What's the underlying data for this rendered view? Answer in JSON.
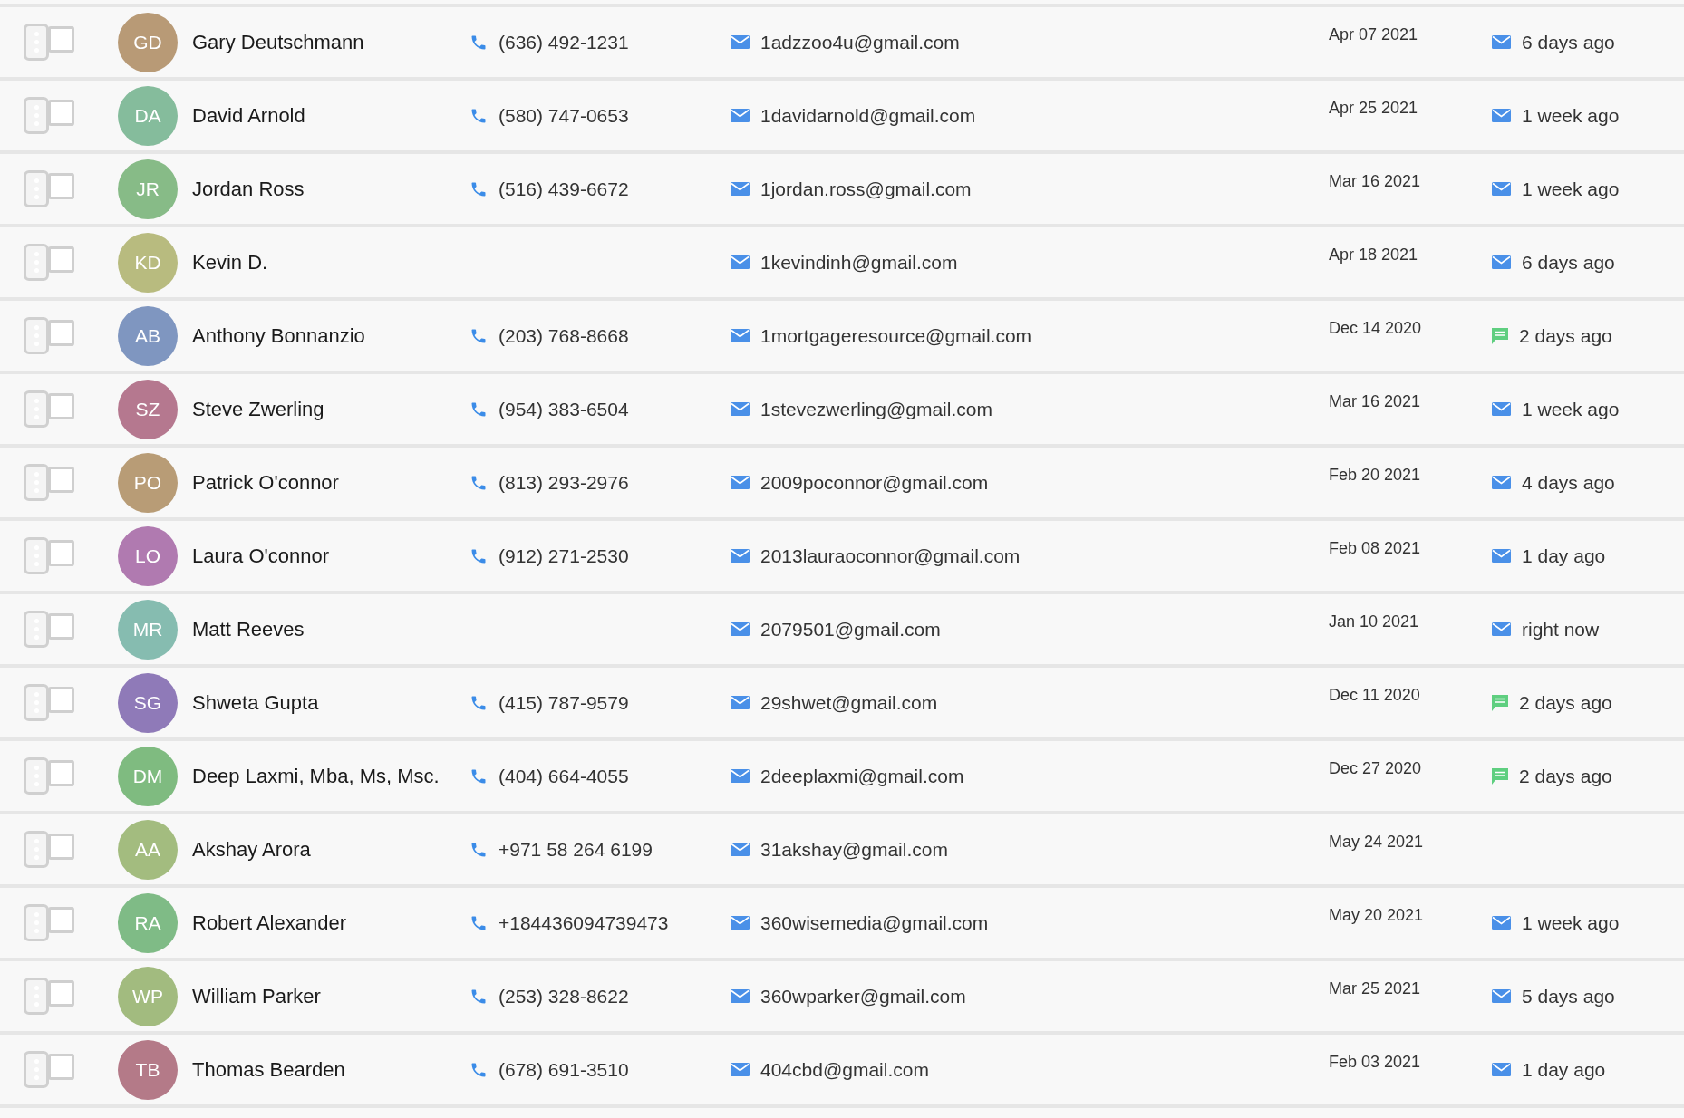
{
  "contacts": [
    {
      "initials": "GD",
      "color": "#b89a76",
      "name": "Gary Deutschmann",
      "checked": false,
      "phone": "(636) 492-1231",
      "email": "1adzzoo4u@gmail.com",
      "date": "Apr 07 2021",
      "last_contact": {
        "kind": "email",
        "text": "6 days ago"
      }
    },
    {
      "initials": "DA",
      "color": "#85bc9c",
      "name": "David Arnold",
      "checked": false,
      "phone": "(580) 747-0653",
      "email": "1davidarnold@gmail.com",
      "date": "Apr 25 2021",
      "last_contact": {
        "kind": "email",
        "text": "1 week ago"
      }
    },
    {
      "initials": "JR",
      "color": "#87bb87",
      "name": "Jordan Ross",
      "checked": false,
      "phone": "(516) 439-6672",
      "email": "1jordan.ross@gmail.com",
      "date": "Mar 16 2021",
      "last_contact": {
        "kind": "email",
        "text": "1 week ago"
      }
    },
    {
      "initials": "KD",
      "color": "#b8bb7f",
      "name": "Kevin D.",
      "checked": false,
      "email": "1kevindinh@gmail.com",
      "date": "Apr 18 2021",
      "last_contact": {
        "kind": "email",
        "text": "6 days ago"
      }
    },
    {
      "initials": "AB",
      "color": "#7f96c0",
      "name": "Anthony Bonnanzio",
      "checked": false,
      "phone": "(203) 768-8668",
      "email": "1mortgageresource@gmail.com",
      "date": "Dec 14 2020",
      "last_contact": {
        "kind": "message",
        "text": "2 days ago"
      }
    },
    {
      "initials": "SZ",
      "color": "#b5788f",
      "name": "Steve Zwerling",
      "checked": false,
      "phone": "(954) 383-6504",
      "email": "1stevezwerling@gmail.com",
      "date": "Mar 16 2021",
      "last_contact": {
        "kind": "email",
        "text": "1 week ago"
      }
    },
    {
      "initials": "PO",
      "color": "#b89c76",
      "name": "Patrick O'connor",
      "checked": false,
      "phone": "(813) 293-2976",
      "email": "2009poconnor@gmail.com",
      "date": "Feb 20 2021",
      "last_contact": {
        "kind": "email",
        "text": "4 days ago"
      }
    },
    {
      "initials": "LO",
      "color": "#b07ab0",
      "name": "Laura O'connor",
      "checked": false,
      "phone": "(912) 271-2530",
      "email": "2013lauraoconnor@gmail.com",
      "date": "Feb 08 2021",
      "last_contact": {
        "kind": "email",
        "text": "1 day ago"
      }
    },
    {
      "initials": "MR",
      "color": "#86bcb0",
      "name": "Matt Reeves",
      "checked": false,
      "email": "2079501@gmail.com",
      "date": "Jan 10 2021",
      "last_contact": {
        "kind": "email",
        "text": "right now"
      }
    },
    {
      "initials": "SG",
      "color": "#8f7ab8",
      "name": "Shweta Gupta",
      "checked": false,
      "phone": "(415) 787-9579",
      "email": "29shwet@gmail.com",
      "date": "Dec 11 2020",
      "last_contact": {
        "kind": "message",
        "text": "2 days ago"
      }
    },
    {
      "initials": "DM",
      "color": "#7fbb80",
      "name": "Deep Laxmi, Mba, Ms, Msc.",
      "checked": false,
      "phone": "(404) 664-4055",
      "email": "2deeplaxmi@gmail.com",
      "date": "Dec 27 2020",
      "last_contact": {
        "kind": "message",
        "text": "2 days ago"
      }
    },
    {
      "initials": "AA",
      "color": "#a3bc7f",
      "name": "Akshay Arora",
      "checked": false,
      "phone": "+971 58 264 6199",
      "email": "31akshay@gmail.com",
      "date": "May 24 2021"
    },
    {
      "initials": "RA",
      "color": "#7fbb86",
      "name": "Robert Alexander",
      "checked": false,
      "phone": "+184436094739473",
      "email": "360wisemedia@gmail.com",
      "date": "May 20 2021",
      "last_contact": {
        "kind": "email",
        "text": "1 week ago"
      }
    },
    {
      "initials": "WP",
      "color": "#a2bb7f",
      "name": "William Parker",
      "checked": false,
      "phone": "(253) 328-8622",
      "email": "360wparker@gmail.com",
      "date": "Mar 25 2021",
      "last_contact": {
        "kind": "email",
        "text": "5 days ago"
      }
    },
    {
      "initials": "TB",
      "color": "#b47a88",
      "name": "Thomas Bearden",
      "checked": false,
      "phone": "(678) 691-3510",
      "email": "404cbd@gmail.com",
      "date": "Feb 03 2021",
      "last_contact": {
        "kind": "email",
        "text": "1 day ago"
      }
    }
  ]
}
